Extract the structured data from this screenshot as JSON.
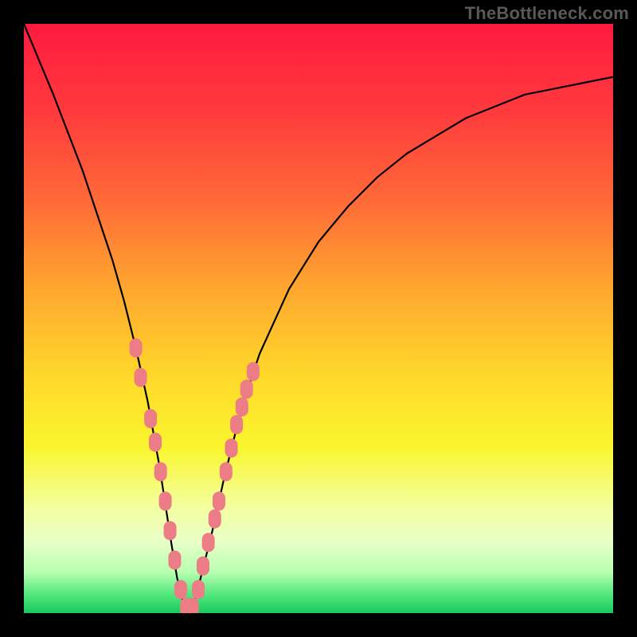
{
  "watermark": "TheBottleneck.com",
  "colors": {
    "frame": "#000000",
    "curve": "#000000",
    "marker": "#ec7c85",
    "gradient_stops": [
      {
        "offset": 0.0,
        "color": "#ff1a3f"
      },
      {
        "offset": 0.15,
        "color": "#ff3b3d"
      },
      {
        "offset": 0.3,
        "color": "#ff6a37"
      },
      {
        "offset": 0.45,
        "color": "#ffa72f"
      },
      {
        "offset": 0.6,
        "color": "#ffd92a"
      },
      {
        "offset": 0.72,
        "color": "#faf62e"
      },
      {
        "offset": 0.82,
        "color": "#f3ffa0"
      },
      {
        "offset": 0.88,
        "color": "#e8ffc8"
      },
      {
        "offset": 0.93,
        "color": "#b8ffb0"
      },
      {
        "offset": 0.97,
        "color": "#4fe67a"
      },
      {
        "offset": 1.0,
        "color": "#19c95d"
      }
    ]
  },
  "chart_data": {
    "type": "line",
    "title": "",
    "xlabel": "",
    "ylabel": "",
    "xlim": [
      0,
      100
    ],
    "ylim": [
      0,
      100
    ],
    "series": [
      {
        "name": "bottleneck-curve",
        "x": [
          0,
          5,
          10,
          15,
          17,
          19,
          21,
          23,
          25,
          26,
          27,
          28,
          29,
          30,
          32,
          34,
          36,
          38,
          40,
          45,
          50,
          55,
          60,
          65,
          70,
          75,
          80,
          85,
          90,
          95,
          100
        ],
        "y": [
          100,
          88,
          75,
          60,
          53,
          45,
          36,
          25,
          12,
          6,
          2,
          0,
          2,
          6,
          14,
          23,
          31,
          38,
          44,
          55,
          63,
          69,
          74,
          78,
          81,
          84,
          86,
          88,
          89,
          90,
          91
        ]
      }
    ],
    "markers": {
      "name": "highlighted-points",
      "points": [
        {
          "x": 19.0,
          "y": 45
        },
        {
          "x": 19.8,
          "y": 40
        },
        {
          "x": 21.5,
          "y": 33
        },
        {
          "x": 22.3,
          "y": 29
        },
        {
          "x": 23.2,
          "y": 24
        },
        {
          "x": 24.0,
          "y": 19
        },
        {
          "x": 24.8,
          "y": 14
        },
        {
          "x": 25.6,
          "y": 9
        },
        {
          "x": 26.6,
          "y": 4
        },
        {
          "x": 27.6,
          "y": 1
        },
        {
          "x": 28.6,
          "y": 1
        },
        {
          "x": 29.6,
          "y": 4
        },
        {
          "x": 30.4,
          "y": 8
        },
        {
          "x": 31.3,
          "y": 12
        },
        {
          "x": 32.4,
          "y": 16
        },
        {
          "x": 33.1,
          "y": 19
        },
        {
          "x": 34.3,
          "y": 24
        },
        {
          "x": 35.2,
          "y": 28
        },
        {
          "x": 36.1,
          "y": 32
        },
        {
          "x": 37.0,
          "y": 35
        },
        {
          "x": 37.8,
          "y": 38
        },
        {
          "x": 38.9,
          "y": 41
        }
      ]
    }
  }
}
